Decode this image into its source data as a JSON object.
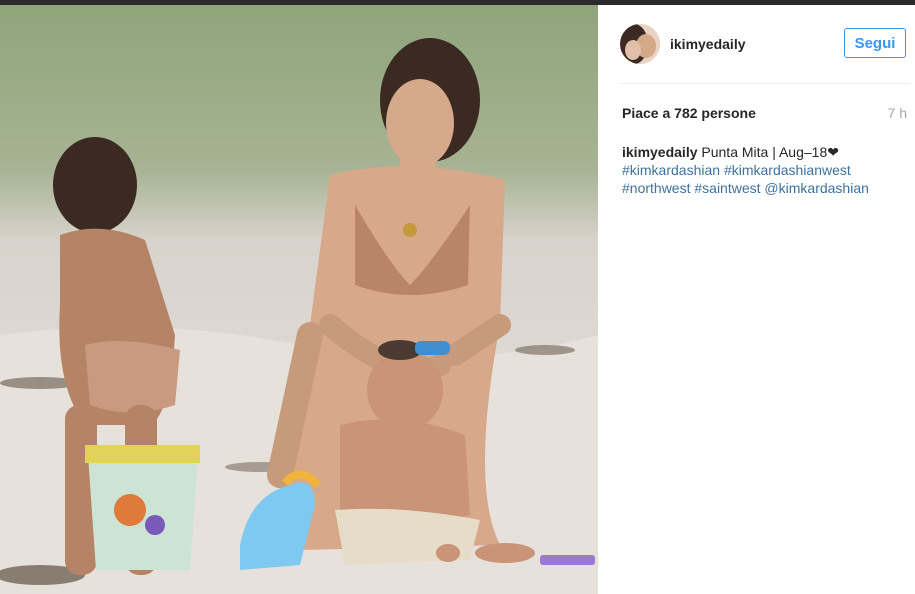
{
  "post": {
    "username": "ikimyedaily",
    "follow_label": "Segui",
    "likes_text": "Piace a 782 persone",
    "time_ago": "7 h",
    "caption_user": "ikimyedaily",
    "caption_text": "Punta Mita | Aug–18❤",
    "tags": {
      "t1": "#kimkardashian",
      "t2": "#kimkardashianwest",
      "t3": "#northwest",
      "t4": "#saintwest",
      "t5": "@kimkardashian"
    }
  },
  "colors": {
    "link": "#3f729b",
    "follow": "#3897f0",
    "text": "#262626",
    "muted": "#a5a7aa"
  },
  "icons": {
    "avatar": "profile-photo"
  }
}
